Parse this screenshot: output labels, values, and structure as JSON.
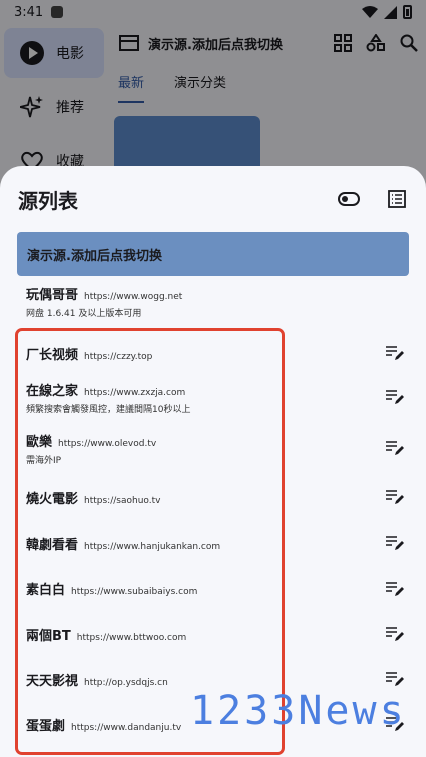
{
  "status_bar": {
    "time": "3:41"
  },
  "rail": {
    "items": [
      {
        "label": "电影",
        "active": true
      },
      {
        "label": "推荐"
      },
      {
        "label": "收藏"
      }
    ]
  },
  "topbar": {
    "title": "演示源.添加后点我切换"
  },
  "tabs": [
    {
      "label": "最新"
    },
    {
      "label": "演示分类"
    }
  ],
  "sheet": {
    "title": "源列表",
    "selected": "演示源.添加后点我切换",
    "items": [
      {
        "name": "玩偶哥哥",
        "url": "https://www.wogg.net",
        "sub": "网盘 1.6.41 及以上版本可用",
        "editable": false
      },
      {
        "name": "厂长视频",
        "url": "https://czzy.top",
        "sub": ""
      },
      {
        "name": "在線之家",
        "url": "https://www.zxzja.com",
        "sub": "頻繁搜索會觸發風控，建議間隔10秒以上"
      },
      {
        "name": "歐樂",
        "url": "https://www.olevod.tv",
        "sub": "需海外IP"
      },
      {
        "name": "燒火電影",
        "url": "https://saohuo.tv",
        "sub": ""
      },
      {
        "name": "韓劇看看",
        "url": "https://www.hanjukankan.com",
        "sub": ""
      },
      {
        "name": "素白白",
        "url": "https://www.subaibaiys.com",
        "sub": ""
      },
      {
        "name": "兩個BT",
        "url": "https://www.bttwoo.com",
        "sub": ""
      },
      {
        "name": "天天影視",
        "url": "http://op.ysdqjs.cn",
        "sub": ""
      },
      {
        "name": "蛋蛋劇",
        "url": "https://www.dandanju.tv",
        "sub": ""
      }
    ]
  },
  "watermark": "1233News",
  "colors": {
    "accent": "#345ca8",
    "selected_row": "#6b8fc0",
    "highlight_box": "#e0422f",
    "watermark": "#4c7fe0"
  }
}
